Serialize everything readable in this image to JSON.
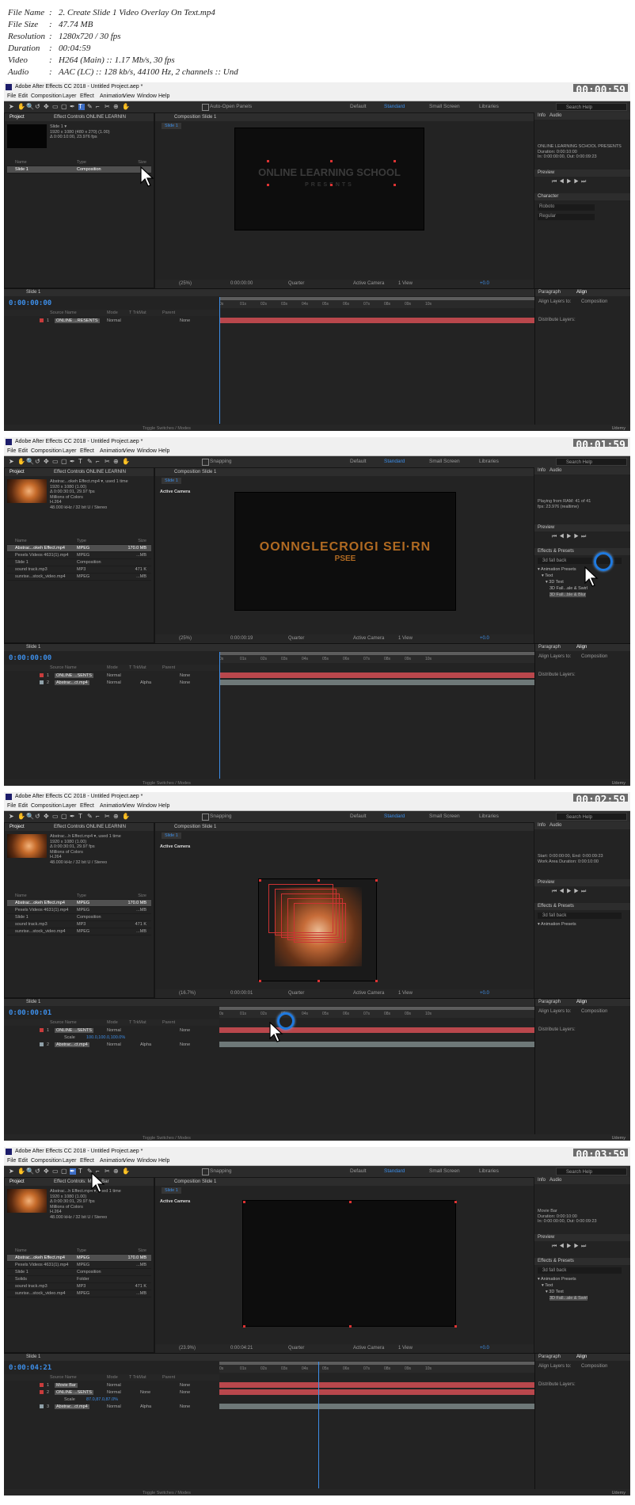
{
  "file_info": [
    {
      "key": "File Name",
      "value": "2. Create Slide 1 Video Overlay On Text.mp4"
    },
    {
      "key": "File Size",
      "value": "47.74 MB"
    },
    {
      "key": "Resolution",
      "value": "1280x720 / 30 fps"
    },
    {
      "key": "Duration",
      "value": "00:04:59"
    },
    {
      "key": "Video",
      "value": "H264 (Main) :: 1.17 Mb/s, 30 fps"
    },
    {
      "key": "Audio",
      "value": "AAC (LC) :: 128 kb/s, 44100 Hz, 2 channels :: Und"
    }
  ],
  "app": {
    "title": "Adobe After Effects CC 2018 - Untitled Project.aep *",
    "menu": [
      "File",
      "Edit",
      "Composition",
      "Layer",
      "Effect",
      "Animation",
      "View",
      "Window",
      "Help"
    ],
    "workspaces": [
      "Default",
      "Standard",
      "Small Screen",
      "Libraries"
    ],
    "search_placeholder": "Search Help",
    "auto_open": "Auto-Open Panels",
    "snapping": "Snapping",
    "watermark": "Udemy"
  },
  "frames": [
    {
      "clock": "00:00:59",
      "project_tab": "Project",
      "effect_tab": "Effect Controls ONLINE LEARNIN",
      "comp_tab": "Composition Slide 1",
      "comp_sub": "Slide 1",
      "active_camera": "",
      "proj_meta": "Slide 1 ▾\n1920 x 1080 (480 x 270) (1.00)\nΔ 0:00:10:00, 23.976 fps",
      "proj_list": [
        {
          "name": "Slide 1",
          "type": "Composition",
          "size": "",
          "sel": true
        }
      ],
      "canvas_line1": "ONLINE LEARNING SCHOOL",
      "canvas_line2": "PRESENTS",
      "zoom": "(25%)",
      "viewer_time": "0:00:00:00",
      "quality": "Quarter",
      "camera": "Active Camera",
      "view": "1 View",
      "offset": "+0.0",
      "info_text": "ONLINE LEARNING SCHOOL PRESENTS\nDuration: 0:00:10:00\nIn: 0:00:00:00, Out: 0:00:09:23",
      "preview": "Preview",
      "character": "Character",
      "font": "Roboto",
      "style": "Regular",
      "tl_tab": "Slide 1",
      "tl_time": "0:00:00:00",
      "layers": [
        {
          "num": "1",
          "name": "ONLINE ...RESENTS",
          "mode": "Normal",
          "trk": "",
          "parent": "None",
          "color": "#c83c3c"
        }
      ],
      "paragraph": "Paragraph",
      "align": "Align",
      "align_to": "Align Layers to:",
      "align_target": "Composition",
      "distribute": "Distribute Layers:",
      "toggle": "Toggle Switches / Modes"
    },
    {
      "clock": "00:01:59",
      "project_tab": "Project",
      "effect_tab": "Effect Controls ONLINE LEARNIN",
      "comp_tab": "Composition Slide 1",
      "comp_sub": "Slide 1",
      "active_camera": "Active Camera",
      "proj_meta": "Abstrac...okeh Effect.mp4 ▾, used 1 time\n1920 x 1080 (1.00)\nΔ 0:00:30:01, 29.97 fps\nMillions of Colors\nH.264\n48.000 kHz / 32 bit U / Stereo",
      "proj_list": [
        {
          "name": "Abstrac...okeh Effect.mp4",
          "type": "MPEG",
          "size": "170.0 MB",
          "sel": true
        },
        {
          "name": "Pexels Videos 4631(1).mp4",
          "type": "MPEG",
          "size": "...MB",
          "sel": false
        },
        {
          "name": "Slide 1",
          "type": "Composition",
          "size": "",
          "sel": false
        },
        {
          "name": "sound track.mp3",
          "type": "MP3",
          "size": "471 K",
          "sel": false
        },
        {
          "name": "sunrise...stock_video.mp4",
          "type": "MPEG",
          "size": "...MB",
          "sel": false
        }
      ],
      "canvas_line1": "OONNGLECROIGI SEI·RN",
      "canvas_line2": "PSEE",
      "zoom": "(25%)",
      "viewer_time": "0:00:00:19",
      "quality": "Quarter",
      "camera": "Active Camera",
      "view": "1 View",
      "offset": "+0.0",
      "info_text": "Playing from RAM: 41 of 41\nfps: 23.976 (realtime)",
      "preview": "Preview",
      "effects": "Effects & Presets",
      "effects_search": "3d fall back",
      "tree": [
        "▾ Animation Presets",
        "▾ Text",
        "▾ 3D Text",
        "3D Fall...ale & Swirl",
        "3D Fall...ble & Blur"
      ],
      "tl_tab": "Slide 1",
      "tl_time": "0:00:00:00",
      "layers": [
        {
          "num": "1",
          "name": "ONLINE ...SENTS",
          "mode": "Normal",
          "trk": "",
          "parent": "None",
          "color": "#c83c3c"
        },
        {
          "num": "2",
          "name": "Abstrac...ct.mp4",
          "mode": "Normal",
          "trk": "Alpha",
          "parent": "None",
          "color": "#8fa0a8"
        }
      ],
      "paragraph": "Paragraph",
      "align": "Align",
      "align_to": "Align Layers to:",
      "align_target": "Composition",
      "distribute": "Distribute Layers:",
      "toggle": "Toggle Switches / Modes"
    },
    {
      "clock": "00:02:59",
      "project_tab": "Project",
      "effect_tab": "Effect Controls ONLINE LEARNIN",
      "comp_tab": "Composition Slide 1",
      "comp_sub": "Slide 1",
      "active_camera": "Active Camera",
      "proj_meta": "Abstrac...h Effect.mp4 ▾, used 1 time\n1920 x 1080 (1.00)\nΔ 0:00:30:01, 29.97 fps\nMillions of Colors\nH.264\n48.000 kHz / 32 bit U / Stereo",
      "proj_list": [
        {
          "name": "Abstrac...okeh Effect.mp4",
          "type": "MPEG",
          "size": "170.0 MB",
          "sel": true
        },
        {
          "name": "Pexels Videos 4631(1).mp4",
          "type": "MPEG",
          "size": "...MB",
          "sel": false
        },
        {
          "name": "Slide 1",
          "type": "Composition",
          "size": "",
          "sel": false
        },
        {
          "name": "sound track.mp3",
          "type": "MP3",
          "size": "471 K",
          "sel": false
        },
        {
          "name": "sunrise...stock_video.mp4",
          "type": "MPEG",
          "size": "...MB",
          "sel": false
        }
      ],
      "canvas_line1": "",
      "canvas_line2": "",
      "zoom": "(16.7%)",
      "viewer_time": "0:00:00:01",
      "quality": "Quarter",
      "camera": "Active Camera",
      "view": "1 View",
      "offset": "+0.0",
      "info_text": "Start: 0:00:00:00, End: 0:00:09:23\nWork Area Duration: 0:00:10:00",
      "preview": "Preview",
      "effects": "Effects & Presets",
      "effects_search": "3d fall back",
      "tree": [
        "▾ Animation Presets"
      ],
      "tl_tab": "Slide 1",
      "tl_time": "0:00:00:01",
      "layers": [
        {
          "num": "1",
          "name": "ONLINE ...SENTS",
          "mode": "Normal",
          "trk": "",
          "parent": "None",
          "color": "#c83c3c"
        },
        {
          "num": "",
          "name": "Scale",
          "mode": "100.0,100.0,100.0%",
          "trk": "",
          "parent": "",
          "color": ""
        },
        {
          "num": "2",
          "name": "Abstrac...ct.mp4",
          "mode": "Normal",
          "trk": "Alpha",
          "parent": "None",
          "color": "#8fa0a8"
        }
      ],
      "paragraph": "Paragraph",
      "align": "Align",
      "align_to": "Align Layers to:",
      "align_target": "Composition",
      "distribute": "Distribute Layers:",
      "toggle": "Toggle Switches / Modes"
    },
    {
      "clock": "00:03:59",
      "project_tab": "Project",
      "effect_tab": "Effect Controls: Movie Bar",
      "comp_tab": "Composition Slide 1",
      "comp_sub": "Slide 1",
      "active_camera": "Active Camera",
      "proj_meta": "Abstrac...h Effect.mp4 ▾, used 1 time\n1920 x 1080 (1.00)\nΔ 0:00:30:01, 29.97 fps\nMillions of Colors\nH.264\n48.000 kHz / 32 bit U / Stereo",
      "proj_list": [
        {
          "name": "Abstrac...okeh Effect.mp4",
          "type": "MPEG",
          "size": "170.0 MB",
          "sel": true
        },
        {
          "name": "Pexels Videos 4631(1).mp4",
          "type": "MPEG",
          "size": "...MB",
          "sel": false
        },
        {
          "name": "Slide 1",
          "type": "Composition",
          "size": "",
          "sel": false
        },
        {
          "name": "Solids",
          "type": "Folder",
          "size": "",
          "sel": false
        },
        {
          "name": "sound track.mp3",
          "type": "MP3",
          "size": "471 K",
          "sel": false
        },
        {
          "name": "sunrise...stock_video.mp4",
          "type": "MPEG",
          "size": "...MB",
          "sel": false
        }
      ],
      "canvas_line1": "",
      "canvas_line2": "",
      "zoom": "(23.9%)",
      "viewer_time": "0:00:04:21",
      "quality": "Quarter",
      "camera": "Active Camera",
      "view": "1 View",
      "offset": "+0.0",
      "info_text": "Movie Bar\nDuration: 0:00:10:00\nIn: 0:00:00:00, Out: 0:00:09:23",
      "preview": "Preview",
      "effects": "Effects & Presets",
      "effects_search": "3d fall back",
      "tree": [
        "▾ Animation Presets",
        "▾ Text",
        "▾ 3D Text",
        "3D Fall...ale & Swirl"
      ],
      "tl_tab": "Slide 1",
      "tl_time": "0:00:04:21",
      "layers": [
        {
          "num": "1",
          "name": "Movie Bar",
          "mode": "Normal",
          "trk": "",
          "parent": "None",
          "color": "#c83c3c"
        },
        {
          "num": "2",
          "name": "ONLINE ...SENTS",
          "mode": "Normal",
          "trk": "None",
          "parent": "None",
          "color": "#c83c3c"
        },
        {
          "num": "",
          "name": "Scale",
          "mode": "87.0,87.0,87.0%",
          "trk": "",
          "parent": "",
          "color": ""
        },
        {
          "num": "3",
          "name": "Abstrac...ct.mp4",
          "mode": "Normal",
          "trk": "Alpha",
          "parent": "None",
          "color": "#8fa0a8"
        }
      ],
      "paragraph": "Paragraph",
      "align": "Align",
      "align_to": "Align Layers to:",
      "align_target": "Composition",
      "distribute": "Distribute Layers:",
      "toggle": "Toggle Switches / Modes"
    }
  ],
  "ruler": [
    "0s",
    "01s",
    "02s",
    "03s",
    "04s",
    "05s",
    "06s",
    "07s",
    "08s",
    "09s",
    "10s"
  ],
  "colors": {
    "accent": "#3d8ee8",
    "layer_bar_red": "#b9474c",
    "layer_bar_grey": "#6e7878",
    "ring": "#1f7ae0"
  }
}
